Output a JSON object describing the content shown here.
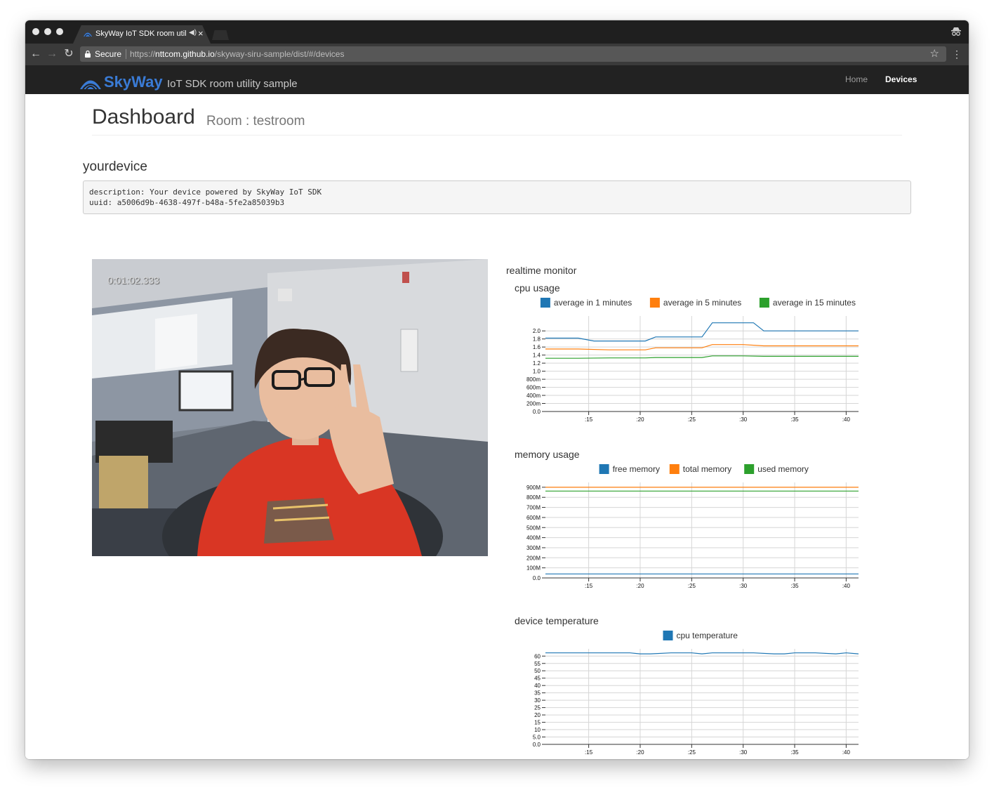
{
  "browser": {
    "tab_title": "SkyWay IoT SDK room utility sample",
    "omnibox": {
      "secure_label": "Secure",
      "url_scheme": "https://",
      "url_host": "nttcom.github.io",
      "url_path": "/skyway-siru-sample/dist/#/devices"
    }
  },
  "navbar": {
    "brand_name": "SkyWay",
    "brand_sub": "IoT SDK room utility sample",
    "links": [
      {
        "label": "Home",
        "active": false
      },
      {
        "label": "Devices",
        "active": true
      }
    ]
  },
  "page": {
    "title": "Dashboard",
    "subtitle": "Room : testroom"
  },
  "device": {
    "name": "yourdevice",
    "description_line": "description: Your device powered by SkyWay IoT SDK",
    "uuid_line": "uuid: a5006d9b-4638-497f-b48a-5fe2a85039b3",
    "video_timecode": "0:01:02.333"
  },
  "monitor": {
    "title": "realtime monitor"
  },
  "colors": {
    "blue": "#1f77b4",
    "orange": "#ff7f0e",
    "green": "#2ca02c",
    "brand": "#3a7bd5",
    "navbar": "#222222"
  },
  "chart_data": [
    {
      "type": "line",
      "title": "cpu usage",
      "xticks": [
        ":15",
        ":20",
        ":25",
        ":30",
        ":35",
        ":40"
      ],
      "xticks_at": [
        15,
        20,
        25,
        30,
        35,
        40
      ],
      "xlim": [
        10.8,
        41.2
      ],
      "ylim": [
        0,
        2.3
      ],
      "yticks": [
        0,
        0.2,
        0.4,
        0.6,
        0.8,
        1.0,
        1.2,
        1.4,
        1.6,
        1.8,
        2.0
      ],
      "yticklabels": [
        "0.0",
        "200m",
        "400m",
        "600m",
        "800m",
        "1.0",
        "1.2",
        "1.4",
        "1.6",
        "1.8",
        "2.0"
      ],
      "grid": true,
      "legend": "top",
      "series": [
        {
          "name": "average in 1 minutes",
          "color": "#1f77b4",
          "x": [
            10.8,
            12,
            14,
            15.5,
            17,
            19,
            20.5,
            21.5,
            23,
            24,
            25.5,
            26,
            27,
            28,
            29,
            30,
            31,
            32,
            33,
            35,
            37,
            39,
            41.2
          ],
          "y": [
            1.82,
            1.82,
            1.82,
            1.75,
            1.75,
            1.75,
            1.75,
            1.85,
            1.85,
            1.85,
            1.85,
            1.85,
            2.2,
            2.2,
            2.2,
            2.2,
            2.2,
            2.0,
            2.0,
            2.0,
            2.0,
            2.0,
            2.0
          ]
        },
        {
          "name": "average in 5 minutes",
          "color": "#ff7f0e",
          "x": [
            10.8,
            14,
            17,
            20.5,
            21.5,
            26,
            27,
            30,
            32,
            35,
            38,
            41.2
          ],
          "y": [
            1.55,
            1.55,
            1.53,
            1.53,
            1.58,
            1.58,
            1.66,
            1.66,
            1.63,
            1.63,
            1.63,
            1.63
          ]
        },
        {
          "name": "average in 15 minutes",
          "color": "#2ca02c",
          "x": [
            10.8,
            14,
            17,
            20.5,
            21.5,
            26,
            27,
            30,
            32,
            35,
            38,
            41.2
          ],
          "y": [
            1.32,
            1.32,
            1.33,
            1.33,
            1.34,
            1.34,
            1.38,
            1.38,
            1.37,
            1.37,
            1.37,
            1.37
          ]
        }
      ]
    },
    {
      "type": "line",
      "title": "memory usage",
      "xticks": [
        ":15",
        ":20",
        ":25",
        ":30",
        ":35",
        ":40"
      ],
      "xticks_at": [
        15,
        20,
        25,
        30,
        35,
        40
      ],
      "xlim": [
        10.8,
        41.2
      ],
      "ylim": [
        0,
        920
      ],
      "yticks": [
        0,
        100,
        200,
        300,
        400,
        500,
        600,
        700,
        800,
        900
      ],
      "yticklabels": [
        "0.0",
        "100M",
        "200M",
        "300M",
        "400M",
        "500M",
        "600M",
        "700M",
        "800M",
        "900M"
      ],
      "grid": true,
      "legend": "top",
      "series": [
        {
          "name": "free memory",
          "color": "#1f77b4",
          "x": [
            10.8,
            41.2
          ],
          "y": [
            40,
            40
          ]
        },
        {
          "name": "total memory",
          "color": "#ff7f0e",
          "x": [
            10.8,
            41.2
          ],
          "y": [
            900,
            900
          ]
        },
        {
          "name": "used memory",
          "color": "#2ca02c",
          "x": [
            10.8,
            41.2
          ],
          "y": [
            862,
            862
          ]
        }
      ]
    },
    {
      "type": "line",
      "title": "device temperature",
      "xticks": [
        ":15",
        ":20",
        ":25",
        ":30",
        ":35",
        ":40"
      ],
      "xticks_at": [
        15,
        20,
        25,
        30,
        35,
        40
      ],
      "xlim": [
        10.8,
        41.2
      ],
      "ylim": [
        0,
        63
      ],
      "yticks": [
        0,
        5,
        10,
        15,
        20,
        25,
        30,
        35,
        40,
        45,
        50,
        55,
        60
      ],
      "yticklabels": [
        "0.0",
        "5.0",
        "10",
        "15",
        "20",
        "25",
        "30",
        "35",
        "40",
        "45",
        "50",
        "55",
        "60"
      ],
      "grid": true,
      "legend": "top",
      "series": [
        {
          "name": "cpu temperature",
          "color": "#1f77b4",
          "x": [
            10.8,
            13,
            15,
            17,
            19,
            20,
            21,
            23,
            25,
            26,
            27,
            29,
            31,
            33,
            34,
            35,
            37,
            39,
            40,
            41.2
          ],
          "y": [
            62.2,
            62.2,
            62.2,
            62.2,
            62.2,
            61.5,
            61.5,
            62.2,
            62.2,
            61.5,
            62.2,
            62.2,
            62.2,
            61.5,
            61.5,
            62.2,
            62.2,
            61.5,
            62.2,
            61.5
          ]
        }
      ]
    }
  ]
}
